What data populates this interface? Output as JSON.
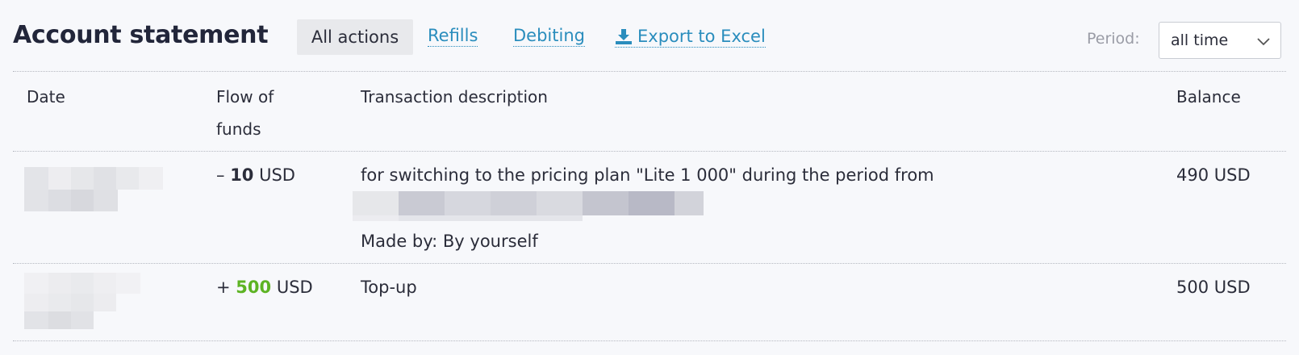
{
  "header": {
    "title": "Account statement",
    "filters": [
      {
        "label": "All actions",
        "active": true
      },
      {
        "label": "Refills",
        "active": false
      },
      {
        "label": "Debiting",
        "active": false
      }
    ],
    "export_label": "Export to Excel",
    "period_label": "Period:",
    "period_value": "all time"
  },
  "table": {
    "columns": [
      "Date",
      "Flow of funds",
      "Transaction description",
      "Balance"
    ],
    "rows": [
      {
        "flow_sign": "–",
        "flow_amount": "10",
        "flow_currency": "USD",
        "description": "for switching to the pricing plan \"Lite 1 000\" during the period from",
        "made_by": "Made by: By yourself",
        "balance": "490 USD"
      },
      {
        "flow_sign": "+",
        "flow_amount": "500",
        "flow_currency": "USD",
        "description": "Top-up",
        "balance": "500 USD"
      }
    ]
  },
  "colors": {
    "link": "#2a8dbd",
    "positive_amount": "#5db323",
    "title": "#22263a"
  },
  "icons": [
    "download-icon",
    "chevron-down-icon"
  ]
}
